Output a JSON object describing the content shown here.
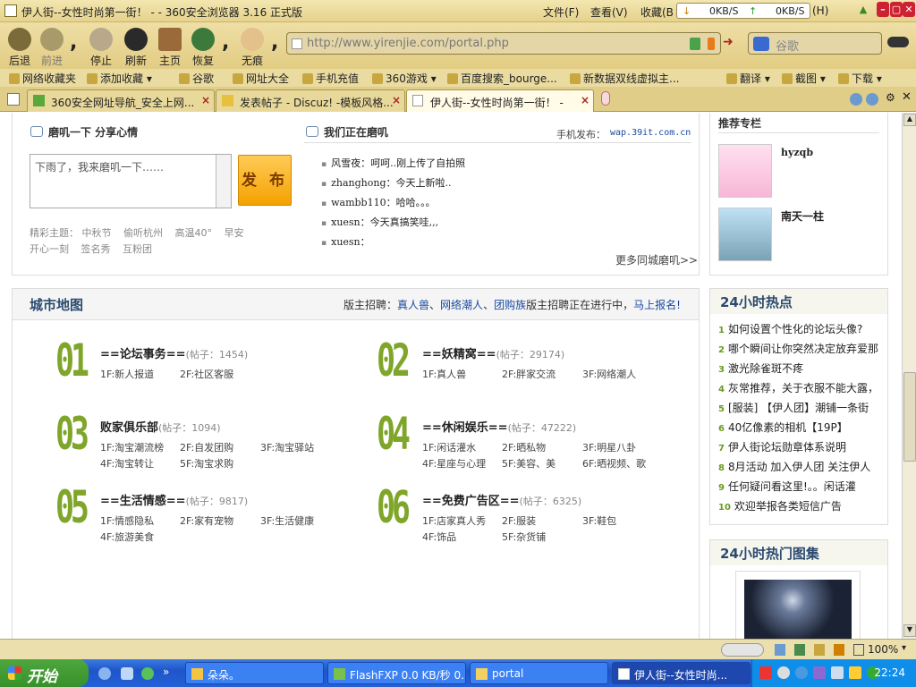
{
  "window": {
    "title": "伊人街--女性时尚第一街！ - - 360安全浏览器 3.16 正式版",
    "menu": [
      "文件(F)",
      "查看(V)",
      "收藏(B",
      "(H)"
    ],
    "net_down": "0KB/S",
    "net_up": "0KB/S"
  },
  "toolbar": {
    "back": "后退",
    "forward": "前进",
    "stop": "停止",
    "refresh": "刷新",
    "home": "主页",
    "restore": "恢复",
    "no_trace": "无痕",
    "url": "http://www.yirenjie.com/portal.php",
    "search_placeholder": "谷歌"
  },
  "bookmarks": [
    "网络收藏夹",
    "添加收藏",
    "谷歌",
    "网址大全",
    "手机充值",
    "360游戏",
    "百度搜索_bourge...",
    "新数据双线虚拟主...",
    "翻译",
    "截图",
    "下载"
  ],
  "tabs": [
    {
      "label": "360安全网址导航_安全上网..."
    },
    {
      "label": "发表帖子 - Discuz! -模板风格..."
    },
    {
      "label": "伊人街--女性时尚第一街！ -"
    }
  ],
  "mojiyixia": {
    "heading": "磨叽一下  分享心情",
    "textarea": "下雨了，我来磨叽一下……",
    "publish": "发 布",
    "topics_label": "精彩主题：",
    "topics": [
      "中秋节",
      "偷听杭州",
      "高温40°",
      "早安",
      "开心一刻",
      "签名秀",
      "互粉团"
    ]
  },
  "feed": {
    "heading": "我们正在磨叽",
    "mobile_label": "手机发布：",
    "mobile_url": "wap.39it.com.cn",
    "items": [
      {
        "user": "风雪夜",
        "text": "呵呵..刚上传了自拍照"
      },
      {
        "user": "zhanghong",
        "text": "今天上新啦.."
      },
      {
        "user": "wambb110",
        "text": "哈哈。。。"
      },
      {
        "user": "xuesn",
        "text": "今天真搞笑哇,,,"
      },
      {
        "user": "xuesn",
        "text": ""
      }
    ],
    "more": "更多同城磨叽>>"
  },
  "city": {
    "title": "城市地图",
    "recruit_label": "版主招聘：",
    "recruit_links": [
      "真人兽",
      "网络潮人",
      "团购族"
    ],
    "recruit_text": "版主招聘正在进行中，",
    "apply": "马上报名!",
    "forums": [
      {
        "num": "01",
        "name": "==论坛事务==",
        "posts": "(帖子：1454)",
        "subs": [
          "1F:新人报道",
          "2F:社区客服"
        ]
      },
      {
        "num": "02",
        "name": "==妖精窝==",
        "posts": "(帖子：29174)",
        "subs": [
          "1F:真人兽",
          "2F:胖家交流",
          "3F:网络潮人"
        ]
      },
      {
        "num": "03",
        "name": "败家俱乐部",
        "posts": "(帖子：1094)",
        "subs": [
          "1F:淘宝潮流榜",
          "2F:自发团购",
          "3F:淘宝驿站",
          "4F:淘宝转让",
          "5F:淘宝求购"
        ]
      },
      {
        "num": "04",
        "name": "==休闲娱乐==",
        "posts": "(帖子：47222)",
        "subs": [
          "1F:闲话灌水",
          "2F:晒私物",
          "3F:明星八卦",
          "4F:星座与心理",
          "5F:美容、美",
          "6F:晒视频、歌"
        ]
      },
      {
        "num": "05",
        "name": "==生活情感==",
        "posts": "(帖子：9817)",
        "subs": [
          "1F:情感隐私",
          "2F:家有宠物",
          "3F:生活健康",
          "4F:旅游美食"
        ]
      },
      {
        "num": "06",
        "name": "==免费广告区==",
        "posts": "(帖子：6325)",
        "subs": [
          "1F:店家真人秀",
          "2F:服装",
          "3F:鞋包",
          "4F:饰品",
          "5F:杂货铺"
        ]
      }
    ]
  },
  "sidebar": {
    "recommend_title": "推荐专栏",
    "recommend": [
      {
        "name": "hyzqb"
      },
      {
        "name": "南天一柱"
      }
    ],
    "hot_title": "24小时热点",
    "hot": [
      "如何设置个性化的论坛头像?",
      "哪个瞬间让你突然决定放弃爱那",
      "激光除雀斑不疼",
      "灰常推荐，关于衣服不能大露，",
      "[服装] 【伊人团】潮铺一条街",
      "40亿像素的相机【19P】",
      "伊人街论坛勋章体系说明",
      "8月活动 加入伊人团 关注伊人",
      "任何疑问看这里!。。闲话灌",
      "欢迎举报各类短信广告"
    ],
    "gallery_title": "24小时热门图集"
  },
  "status": {
    "zoom": "100%"
  },
  "taskbar": {
    "start": "开始",
    "tasks": [
      "朵朵。",
      "FlashFXP 0.0 KB/秒 0...",
      "portal",
      "伊人街--女性时尚..."
    ],
    "clock": "22:24"
  }
}
